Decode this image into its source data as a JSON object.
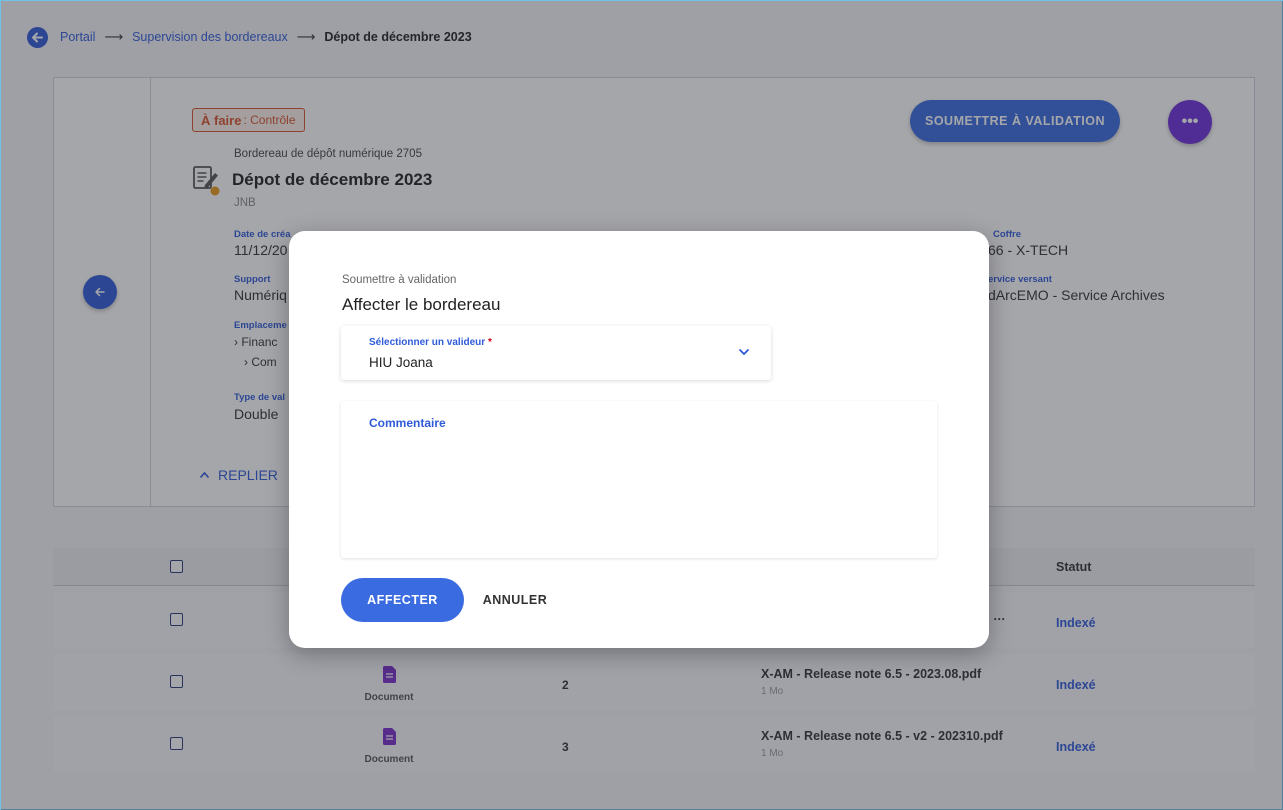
{
  "breadcrumb": {
    "items": [
      "Portail",
      "Supervision des bordereaux"
    ],
    "current": "Dépot de décembre 2023",
    "separator": "⟶"
  },
  "card": {
    "status_strong": "À faire",
    "status_light": ": Contrôle",
    "subtitle": "Bordereau de dépôt numérique 2705",
    "title": "Dépot de décembre 2023",
    "owner": "JNB",
    "fields": {
      "date_label": "Date de créa",
      "date_value": "11/12/20",
      "support_label": "Support",
      "support_value": "Numériq",
      "location_label": "Emplaceme",
      "location_tree": [
        "Financ",
        "Com"
      ],
      "validation_type_label": "Type de val",
      "validation_type_value": "Double",
      "coffre_label": "Coffre",
      "coffre_value": "66 - X-TECH",
      "service_label": "ervice versant",
      "service_value": "dArcEMO - Service Archives"
    },
    "replier_label": "REPLIER",
    "submit_label": "SOUMETTRE À VALIDATION",
    "more_label": "•••"
  },
  "table": {
    "status_header": "Statut",
    "rows": [
      {
        "type": "",
        "num": "",
        "name": "…",
        "size": "",
        "status": "Indexé"
      },
      {
        "type": "Document",
        "num": "2",
        "name": "X-AM - Release note 6.5 - 2023.08.pdf",
        "size": "1 Mo",
        "status": "Indexé"
      },
      {
        "type": "Document",
        "num": "3",
        "name": "X-AM - Release note 6.5 - v2 - 202310.pdf",
        "size": "1 Mo",
        "status": "Indexé"
      }
    ]
  },
  "modal": {
    "overline": "Soumettre à validation",
    "title": "Affecter le bordereau",
    "select_label": "Sélectionner un valideur",
    "required_mark": "*",
    "select_value": "HIU Joana",
    "comment_label": "Commentaire",
    "affect_label": "AFFECTER",
    "cancel_label": "ANNULER"
  },
  "colors": {
    "accent": "#2f5bd9",
    "button": "#3a6be0",
    "more_button": "#6c2fd9",
    "status_tag": "#d9532c",
    "document_icon": "#7b2ec9"
  }
}
